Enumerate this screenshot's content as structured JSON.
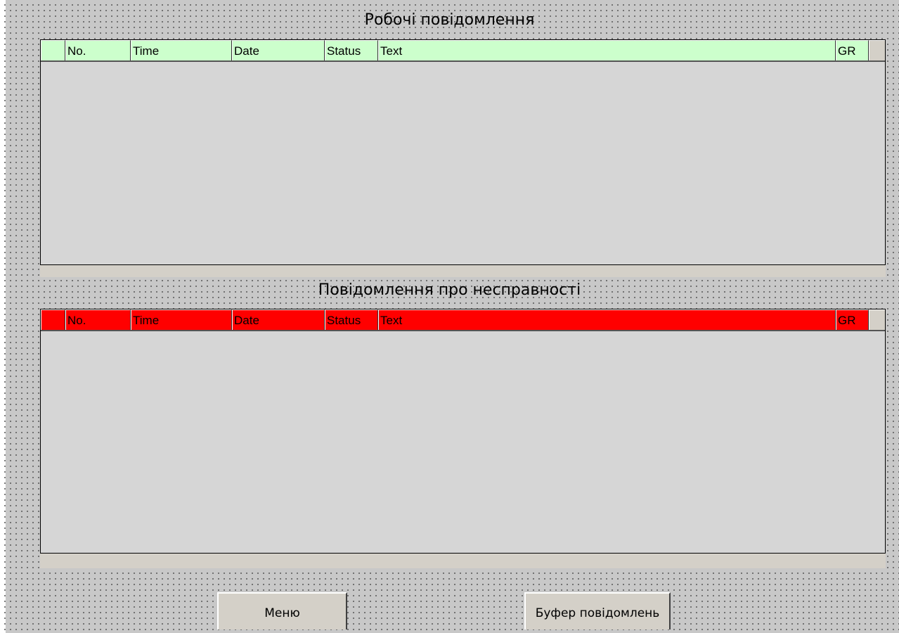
{
  "working_section": {
    "title": "Робочі повідомлення",
    "header_color": "#ccffcc",
    "columns": [
      "",
      "No.",
      "Time",
      "Date",
      "Status",
      "Text",
      "GR",
      ""
    ]
  },
  "fault_section": {
    "title": "Повідомлення про несправності",
    "header_color": "#ff0000",
    "columns": [
      "",
      "No.",
      "Time",
      "Date",
      "Status",
      "Text",
      "GR",
      ""
    ]
  },
  "buttons": {
    "menu_label": "Меню",
    "buffer_label": "Буфер повідомлень"
  }
}
